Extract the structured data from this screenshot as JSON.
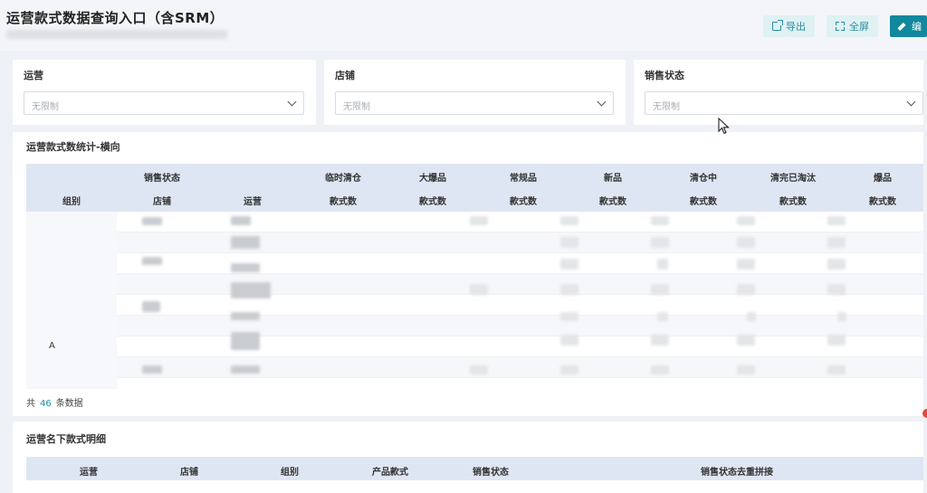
{
  "header": {
    "title": "运营款式数据查询入口（含SRM）",
    "buttons": {
      "export": "导出",
      "fullscreen": "全屏",
      "edit": "编"
    },
    "accent_color": "#11889d"
  },
  "filters": [
    {
      "label": "运营",
      "placeholder": "无限制"
    },
    {
      "label": "店铺",
      "placeholder": "无限制"
    },
    {
      "label": "销售状态",
      "placeholder": "无限制"
    }
  ],
  "stats_table": {
    "title": "运营款式数统计-横向",
    "header_row1": [
      "销售状态",
      "临时清仓",
      "大爆品",
      "常规品",
      "新品",
      "清仓中",
      "清完已淘汰",
      "爆品"
    ],
    "header_row2": [
      "组别",
      "店铺",
      "运营",
      "款式数",
      "款式数",
      "款式数",
      "款式数",
      "款式数",
      "款式数",
      "款式数"
    ],
    "group_value": "A",
    "total": {
      "prefix": "共",
      "count": "46",
      "suffix": "条数据"
    }
  },
  "detail_table": {
    "title": "运营名下款式明细",
    "columns": [
      "运营",
      "店铺",
      "组别",
      "产品款式",
      "销售状态",
      "销售状态去重拼接"
    ]
  }
}
